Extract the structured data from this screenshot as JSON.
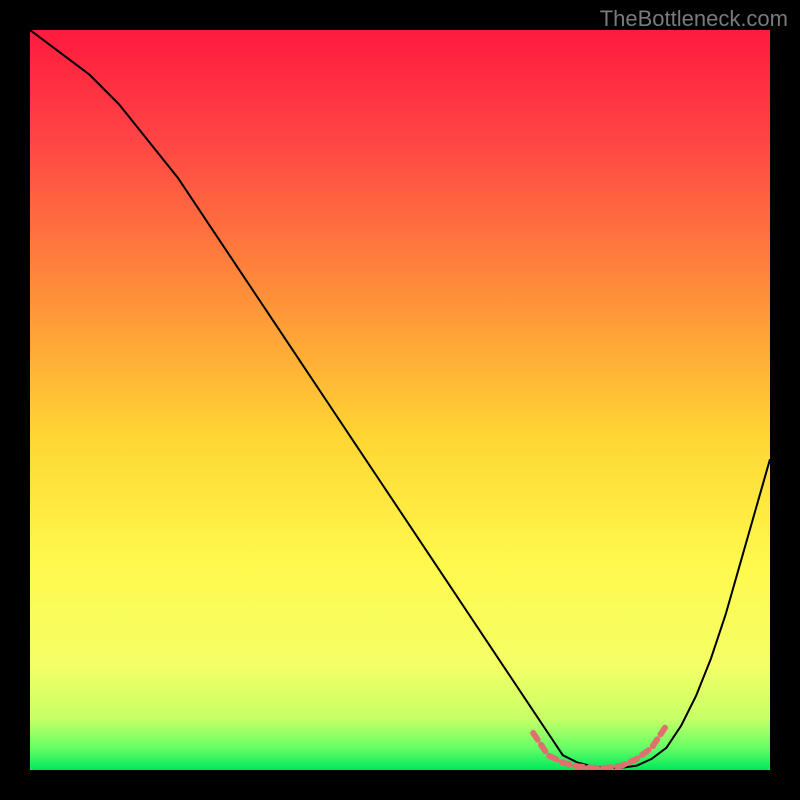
{
  "watermark": "TheBottleneck.com",
  "chart_data": {
    "type": "line",
    "title": "",
    "xlabel": "",
    "ylabel": "",
    "xlim": [
      0,
      100
    ],
    "ylim": [
      0,
      100
    ],
    "grid": false,
    "legend": false,
    "background_gradient": {
      "stops": [
        {
          "offset": 0.0,
          "color": "#ff1a3e"
        },
        {
          "offset": 0.15,
          "color": "#ff4545"
        },
        {
          "offset": 0.35,
          "color": "#ff8c3a"
        },
        {
          "offset": 0.55,
          "color": "#ffd633"
        },
        {
          "offset": 0.72,
          "color": "#fff94d"
        },
        {
          "offset": 0.86,
          "color": "#f4ff66"
        },
        {
          "offset": 0.93,
          "color": "#c8ff66"
        },
        {
          "offset": 0.97,
          "color": "#66ff66"
        },
        {
          "offset": 1.0,
          "color": "#00e85c"
        }
      ]
    },
    "series": [
      {
        "name": "bottleneck-curve",
        "color": "#000000",
        "x": [
          0,
          4,
          8,
          12,
          16,
          20,
          24,
          28,
          32,
          36,
          40,
          44,
          48,
          52,
          56,
          60,
          64,
          68,
          70,
          72,
          74,
          76,
          78,
          80,
          82,
          84,
          86,
          88,
          90,
          92,
          94,
          96,
          98,
          100
        ],
        "y": [
          100,
          97,
          94,
          90,
          85,
          80,
          74,
          68,
          62,
          56,
          50,
          44,
          38,
          32,
          26,
          20,
          14,
          8,
          5,
          2,
          1,
          0.5,
          0.3,
          0.3,
          0.6,
          1.5,
          3,
          6,
          10,
          15,
          21,
          28,
          35,
          42
        ]
      },
      {
        "name": "optimal-range-marker",
        "color": "#e07070",
        "dashed": true,
        "x": [
          68,
          70,
          72,
          74,
          76,
          78,
          80,
          82,
          84,
          86
        ],
        "y": [
          5,
          2,
          1,
          0.5,
          0.3,
          0.3,
          0.6,
          1.5,
          3,
          6
        ]
      }
    ]
  }
}
